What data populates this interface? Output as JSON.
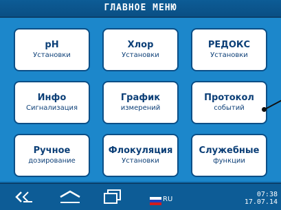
{
  "header": {
    "title": "ГЛАВНОЕ МЕНЮ"
  },
  "menu": [
    {
      "title": "pH",
      "subtitle": "Установки"
    },
    {
      "title": "Хлор",
      "subtitle": "Установки"
    },
    {
      "title": "РЕДОКС",
      "subtitle": "Установки"
    },
    {
      "title": "Инфо",
      "subtitle": "Сигнализация"
    },
    {
      "title": "График",
      "subtitle": "измерений"
    },
    {
      "title": "Протокол",
      "subtitle": "событий"
    },
    {
      "title": "Ручное",
      "subtitle": "дозирование"
    },
    {
      "title": "Флокуляция",
      "subtitle": "Установки"
    },
    {
      "title": "Служебные",
      "subtitle": "функции"
    }
  ],
  "footer": {
    "language": "RU",
    "time": "07:38",
    "date": "17.07.14",
    "icons": [
      "back-icon",
      "home-icon",
      "windows-icon",
      "flag-icon"
    ]
  },
  "colors": {
    "background": "#1c87cb",
    "header": "#0b5490",
    "tile": "#ffffff",
    "text": "#0c3f77"
  }
}
